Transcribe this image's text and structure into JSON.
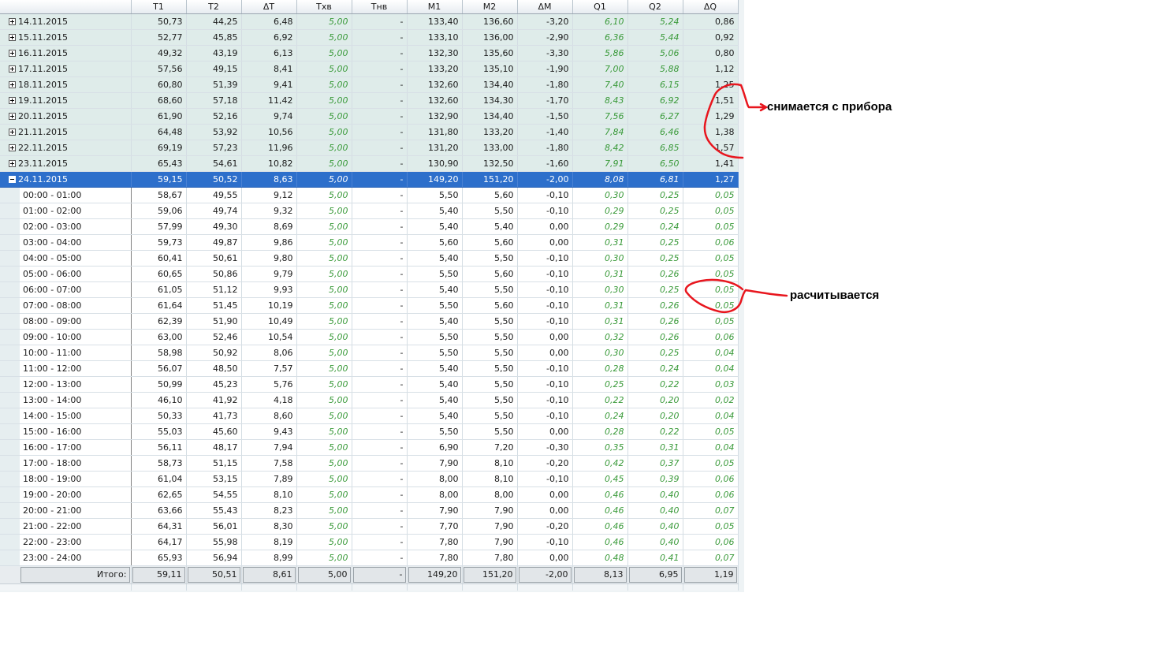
{
  "columns": [
    "T1",
    "T2",
    "ΔT",
    "Tхв",
    "Tнв",
    "M1",
    "M2",
    "ΔM",
    "Q1",
    "Q2",
    "ΔQ"
  ],
  "days": [
    {
      "date": "14.11.2015",
      "v": [
        "50,73",
        "44,25",
        "6,48",
        "5,00",
        "-",
        "133,40",
        "136,60",
        "-3,20",
        "6,10",
        "5,24",
        "0,86"
      ]
    },
    {
      "date": "15.11.2015",
      "v": [
        "52,77",
        "45,85",
        "6,92",
        "5,00",
        "-",
        "133,10",
        "136,00",
        "-2,90",
        "6,36",
        "5,44",
        "0,92"
      ]
    },
    {
      "date": "16.11.2015",
      "v": [
        "49,32",
        "43,19",
        "6,13",
        "5,00",
        "-",
        "132,30",
        "135,60",
        "-3,30",
        "5,86",
        "5,06",
        "0,80"
      ]
    },
    {
      "date": "17.11.2015",
      "v": [
        "57,56",
        "49,15",
        "8,41",
        "5,00",
        "-",
        "133,20",
        "135,10",
        "-1,90",
        "7,00",
        "5,88",
        "1,12"
      ]
    },
    {
      "date": "18.11.2015",
      "v": [
        "60,80",
        "51,39",
        "9,41",
        "5,00",
        "-",
        "132,60",
        "134,40",
        "-1,80",
        "7,40",
        "6,15",
        "1,25"
      ]
    },
    {
      "date": "19.11.2015",
      "v": [
        "68,60",
        "57,18",
        "11,42",
        "5,00",
        "-",
        "132,60",
        "134,30",
        "-1,70",
        "8,43",
        "6,92",
        "1,51"
      ]
    },
    {
      "date": "20.11.2015",
      "v": [
        "61,90",
        "52,16",
        "9,74",
        "5,00",
        "-",
        "132,90",
        "134,40",
        "-1,50",
        "7,56",
        "6,27",
        "1,29"
      ]
    },
    {
      "date": "21.11.2015",
      "v": [
        "64,48",
        "53,92",
        "10,56",
        "5,00",
        "-",
        "131,80",
        "133,20",
        "-1,40",
        "7,84",
        "6,46",
        "1,38"
      ]
    },
    {
      "date": "22.11.2015",
      "v": [
        "69,19",
        "57,23",
        "11,96",
        "5,00",
        "-",
        "131,20",
        "133,00",
        "-1,80",
        "8,42",
        "6,85",
        "1,57"
      ]
    },
    {
      "date": "23.11.2015",
      "v": [
        "65,43",
        "54,61",
        "10,82",
        "5,00",
        "-",
        "130,90",
        "132,50",
        "-1,60",
        "7,91",
        "6,50",
        "1,41"
      ]
    }
  ],
  "selected_day": {
    "date": "24.11.2015",
    "v": [
      "59,15",
      "50,52",
      "8,63",
      "5,00",
      "-",
      "149,20",
      "151,20",
      "-2,00",
      "8,08",
      "6,81",
      "1,27"
    ]
  },
  "hours": [
    {
      "t": "00:00 - 01:00",
      "v": [
        "58,67",
        "49,55",
        "9,12",
        "5,00",
        "-",
        "5,50",
        "5,60",
        "-0,10",
        "0,30",
        "0,25",
        "0,05"
      ]
    },
    {
      "t": "01:00 - 02:00",
      "v": [
        "59,06",
        "49,74",
        "9,32",
        "5,00",
        "-",
        "5,40",
        "5,50",
        "-0,10",
        "0,29",
        "0,25",
        "0,05"
      ]
    },
    {
      "t": "02:00 - 03:00",
      "v": [
        "57,99",
        "49,30",
        "8,69",
        "5,00",
        "-",
        "5,40",
        "5,40",
        "0,00",
        "0,29",
        "0,24",
        "0,05"
      ]
    },
    {
      "t": "03:00 - 04:00",
      "v": [
        "59,73",
        "49,87",
        "9,86",
        "5,00",
        "-",
        "5,60",
        "5,60",
        "0,00",
        "0,31",
        "0,25",
        "0,06"
      ]
    },
    {
      "t": "04:00 - 05:00",
      "v": [
        "60,41",
        "50,61",
        "9,80",
        "5,00",
        "-",
        "5,40",
        "5,50",
        "-0,10",
        "0,30",
        "0,25",
        "0,05"
      ]
    },
    {
      "t": "05:00 - 06:00",
      "v": [
        "60,65",
        "50,86",
        "9,79",
        "5,00",
        "-",
        "5,50",
        "5,60",
        "-0,10",
        "0,31",
        "0,26",
        "0,05"
      ]
    },
    {
      "t": "06:00 - 07:00",
      "v": [
        "61,05",
        "51,12",
        "9,93",
        "5,00",
        "-",
        "5,40",
        "5,50",
        "-0,10",
        "0,30",
        "0,25",
        "0,05"
      ]
    },
    {
      "t": "07:00 - 08:00",
      "v": [
        "61,64",
        "51,45",
        "10,19",
        "5,00",
        "-",
        "5,50",
        "5,60",
        "-0,10",
        "0,31",
        "0,26",
        "0,05"
      ]
    },
    {
      "t": "08:00 - 09:00",
      "v": [
        "62,39",
        "51,90",
        "10,49",
        "5,00",
        "-",
        "5,40",
        "5,50",
        "-0,10",
        "0,31",
        "0,26",
        "0,05"
      ]
    },
    {
      "t": "09:00 - 10:00",
      "v": [
        "63,00",
        "52,46",
        "10,54",
        "5,00",
        "-",
        "5,50",
        "5,50",
        "0,00",
        "0,32",
        "0,26",
        "0,06"
      ]
    },
    {
      "t": "10:00 - 11:00",
      "v": [
        "58,98",
        "50,92",
        "8,06",
        "5,00",
        "-",
        "5,50",
        "5,50",
        "0,00",
        "0,30",
        "0,25",
        "0,04"
      ]
    },
    {
      "t": "11:00 - 12:00",
      "v": [
        "56,07",
        "48,50",
        "7,57",
        "5,00",
        "-",
        "5,40",
        "5,50",
        "-0,10",
        "0,28",
        "0,24",
        "0,04"
      ]
    },
    {
      "t": "12:00 - 13:00",
      "v": [
        "50,99",
        "45,23",
        "5,76",
        "5,00",
        "-",
        "5,40",
        "5,50",
        "-0,10",
        "0,25",
        "0,22",
        "0,03"
      ]
    },
    {
      "t": "13:00 - 14:00",
      "v": [
        "46,10",
        "41,92",
        "4,18",
        "5,00",
        "-",
        "5,40",
        "5,50",
        "-0,10",
        "0,22",
        "0,20",
        "0,02"
      ]
    },
    {
      "t": "14:00 - 15:00",
      "v": [
        "50,33",
        "41,73",
        "8,60",
        "5,00",
        "-",
        "5,40",
        "5,50",
        "-0,10",
        "0,24",
        "0,20",
        "0,04"
      ]
    },
    {
      "t": "15:00 - 16:00",
      "v": [
        "55,03",
        "45,60",
        "9,43",
        "5,00",
        "-",
        "5,50",
        "5,50",
        "0,00",
        "0,28",
        "0,22",
        "0,05"
      ]
    },
    {
      "t": "16:00 - 17:00",
      "v": [
        "56,11",
        "48,17",
        "7,94",
        "5,00",
        "-",
        "6,90",
        "7,20",
        "-0,30",
        "0,35",
        "0,31",
        "0,04"
      ]
    },
    {
      "t": "17:00 - 18:00",
      "v": [
        "58,73",
        "51,15",
        "7,58",
        "5,00",
        "-",
        "7,90",
        "8,10",
        "-0,20",
        "0,42",
        "0,37",
        "0,05"
      ]
    },
    {
      "t": "18:00 - 19:00",
      "v": [
        "61,04",
        "53,15",
        "7,89",
        "5,00",
        "-",
        "8,00",
        "8,10",
        "-0,10",
        "0,45",
        "0,39",
        "0,06"
      ]
    },
    {
      "t": "19:00 - 20:00",
      "v": [
        "62,65",
        "54,55",
        "8,10",
        "5,00",
        "-",
        "8,00",
        "8,00",
        "0,00",
        "0,46",
        "0,40",
        "0,06"
      ]
    },
    {
      "t": "20:00 - 21:00",
      "v": [
        "63,66",
        "55,43",
        "8,23",
        "5,00",
        "-",
        "7,90",
        "7,90",
        "0,00",
        "0,46",
        "0,40",
        "0,07"
      ]
    },
    {
      "t": "21:00 - 22:00",
      "v": [
        "64,31",
        "56,01",
        "8,30",
        "5,00",
        "-",
        "7,70",
        "7,90",
        "-0,20",
        "0,46",
        "0,40",
        "0,05"
      ]
    },
    {
      "t": "22:00 - 23:00",
      "v": [
        "64,17",
        "55,98",
        "8,19",
        "5,00",
        "-",
        "7,80",
        "7,90",
        "-0,10",
        "0,46",
        "0,40",
        "0,06"
      ]
    },
    {
      "t": "23:00 - 24:00",
      "v": [
        "65,93",
        "56,94",
        "8,99",
        "5,00",
        "-",
        "7,80",
        "7,80",
        "0,00",
        "0,48",
        "0,41",
        "0,07"
      ]
    }
  ],
  "total": {
    "label": "Итого:",
    "v": [
      "59,11",
      "50,51",
      "8,61",
      "5,00",
      "-",
      "149,20",
      "151,20",
      "-2,00",
      "8,13",
      "6,95",
      "1,19"
    ]
  },
  "annotations": {
    "device_note": "снимается с прибора",
    "calc_note": "расчитывается",
    "ink_color": "#e8161e"
  },
  "colors": {
    "selection": "#2d6fcb",
    "day_row": "#dfecea",
    "computed_text": "#3a9a3a"
  }
}
